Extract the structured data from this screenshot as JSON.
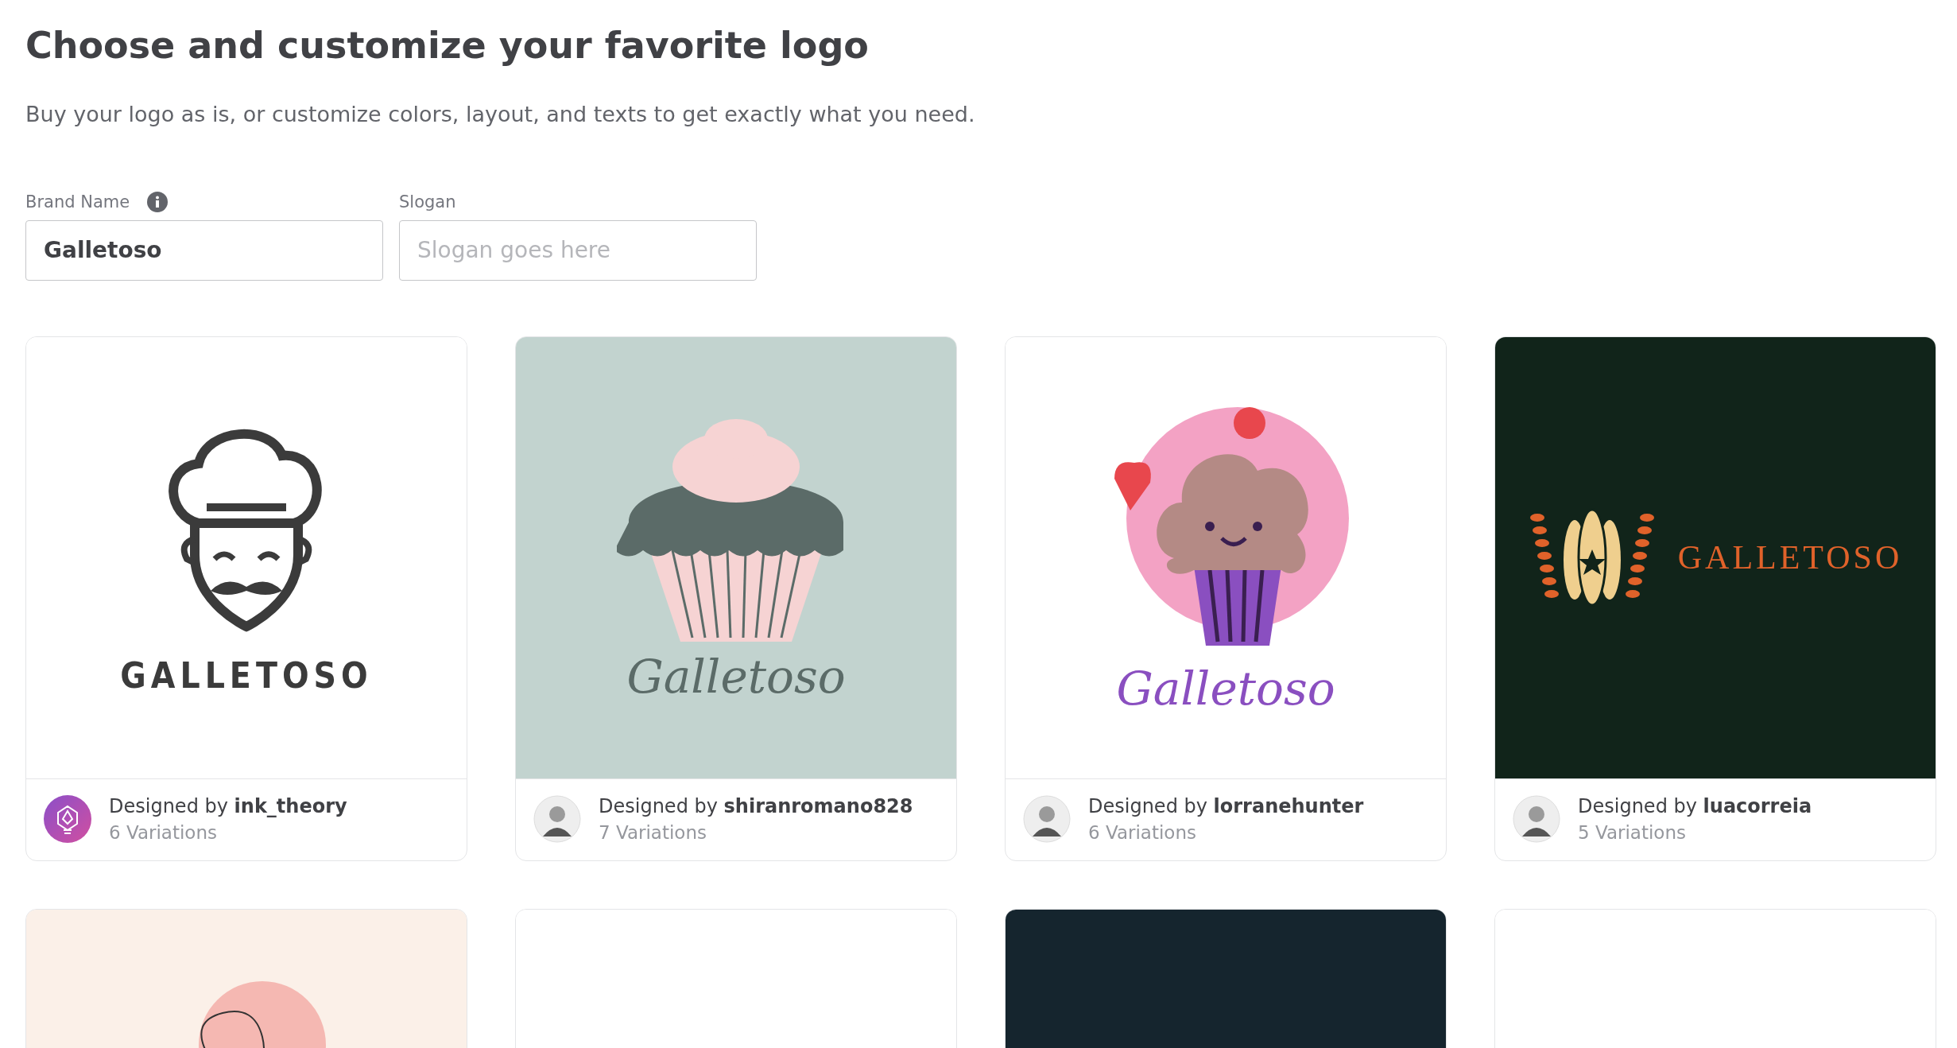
{
  "header": {
    "title": "Choose and customize your favorite logo",
    "subtitle": "Buy your logo as is, or customize colors, layout, and texts to get exactly what you need."
  },
  "fields": [
    {
      "label": "Brand Name",
      "info": true,
      "value": "Galletoso"
    },
    {
      "label": "Slogan",
      "info": false,
      "placeholder": "Slogan goes here"
    }
  ],
  "cards": [
    {
      "kind": "chef",
      "logo_text": "GALLETOSO",
      "designer": "Designed by **ink_theory**",
      "variations": "6 Variations"
    },
    {
      "kind": "cupcake",
      "logo_text": "Galletoso",
      "designer": "Designed by **shiranromano828**",
      "variations": "7 Variations"
    },
    {
      "kind": "cupcake-face",
      "logo_text": "Galletoso",
      "designer": "Designed by **lorranehunter**",
      "variations": "6 Variations"
    },
    {
      "kind": "bread-emblem",
      "logo_text": "GALLETOSO",
      "designer": "Designed by **luacorreia**",
      "variations": "5 Variations"
    },
    {
      "kind": "line-art"
    },
    {
      "kind": "blank-light"
    },
    {
      "kind": "blank-dark"
    },
    {
      "kind": "blank-light"
    }
  ]
}
